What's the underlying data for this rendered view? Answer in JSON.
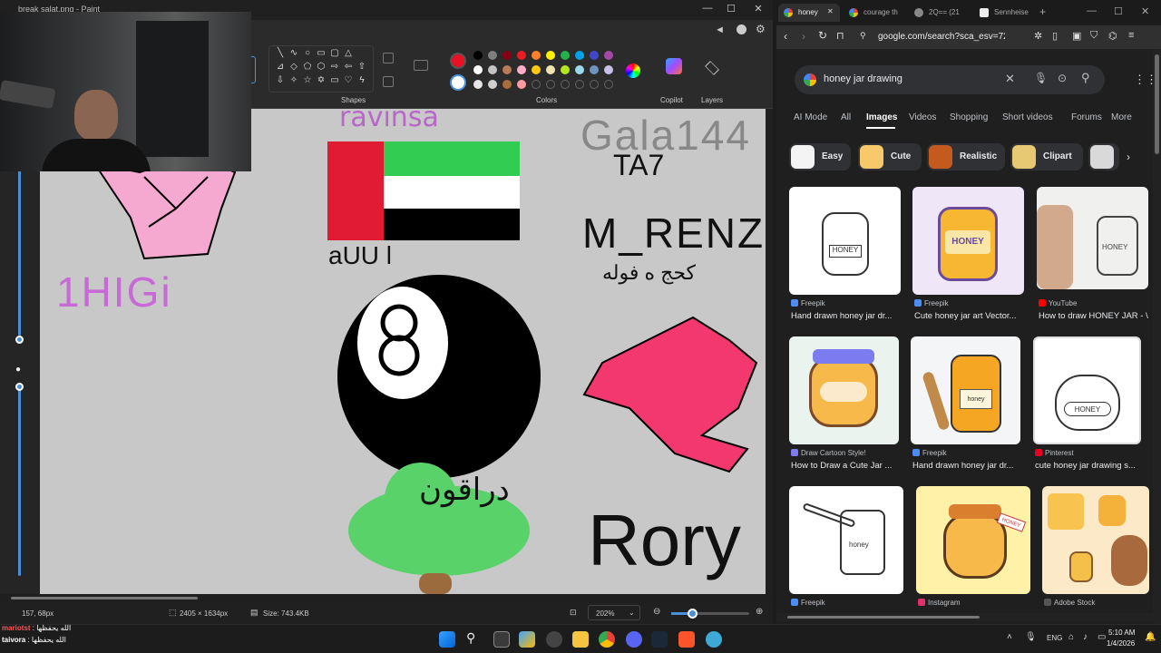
{
  "paint": {
    "window_title": "break salat.png - Paint",
    "groups": {
      "shapes": "Shapes",
      "colors": "Colors",
      "copilot": "Copilot",
      "layers": "Layers"
    },
    "status": {
      "cursor": "157, 68px",
      "dimensions": "2405 × 1634px",
      "size": "Size: 743.4KB",
      "zoom": "202%"
    },
    "canvas_text": {
      "gala": "Gala144",
      "ta7": "TA7",
      "renzo": "M_RENZO",
      "arabic_under_renzo": "كحج ه فوله",
      "flag_label": "aUU l",
      "higi": "1HIGi",
      "arabic_top": "ravinsa",
      "rorys": "Rory",
      "arabic_palm": "دراقون"
    },
    "colors": {
      "red": "#e81224",
      "flag_green": "#33cc52",
      "flag_red": "#e11b34",
      "pink": "#f5a9d1",
      "magenta_text": "#c86ad6",
      "hot_pink": "#f2386e",
      "leaf_green": "#58d269"
    }
  },
  "browser": {
    "tabs": [
      {
        "label": "honey",
        "icon": "google-icon"
      },
      {
        "label": "courage th",
        "icon": "google-icon"
      },
      {
        "label": "2Q== (21",
        "icon": "globe-icon"
      },
      {
        "label": "Sennheise",
        "icon": "amazon-icon"
      }
    ],
    "url": "google.com/search?sca_esv=7232f53e5",
    "search": {
      "query": "honey jar drawing"
    },
    "nav_tabs": [
      "AI Mode",
      "All",
      "Images",
      "Videos",
      "Shopping",
      "Short videos",
      "Forums",
      "More"
    ],
    "chips": [
      "Easy",
      "Cute",
      "Realistic",
      "Clipart"
    ],
    "results": [
      {
        "source": "Freepik",
        "caption": "Hand drawn honey jar dr...",
        "source_color": "#4d8cf5"
      },
      {
        "source": "Freepik",
        "caption": "Cute honey jar art Vector...",
        "source_color": "#4d8cf5"
      },
      {
        "source": "YouTube",
        "caption": "How to draw HONEY JAR - \\",
        "source_color": "#ff0000"
      },
      {
        "source": "Draw Cartoon Style!",
        "caption": "How to Draw a Cute Jar ...",
        "source_color": "#7c7cf0"
      },
      {
        "source": "Freepik",
        "caption": "Hand drawn honey jar dr...",
        "source_color": "#4d8cf5"
      },
      {
        "source": "Pinterest",
        "caption": "cute honey jar drawing s...",
        "source_color": "#e60023"
      },
      {
        "source": "Freepik",
        "caption": "",
        "source_color": "#4d8cf5"
      },
      {
        "source": "Instagram",
        "caption": "",
        "source_color": "#e1306c"
      },
      {
        "source": "Adobe Stock",
        "caption": "",
        "source_color": "#555555"
      }
    ]
  },
  "taskbar": {
    "language": "ENG",
    "time": "5:10 AM",
    "date": "1/4/2026"
  },
  "chat": [
    {
      "user": "mariotst",
      "message": "الله يحفظها"
    },
    {
      "user": "taivora",
      "message": "الله يحفظها"
    }
  ]
}
